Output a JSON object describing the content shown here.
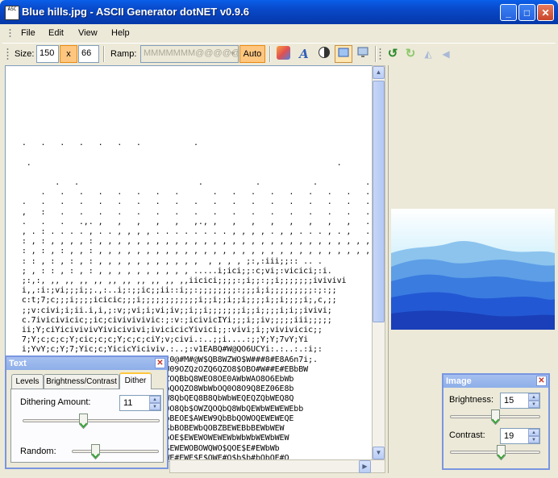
{
  "window": {
    "title": "Blue hills.jpg - ASCII Generator dotNET v0.9.6",
    "app_icon_text": "ASC",
    "controls": {
      "minimize": "_",
      "maximize": "□",
      "close": "✕"
    }
  },
  "menu": {
    "items": [
      "File",
      "Edit",
      "View",
      "Help"
    ]
  },
  "toolbar": {
    "size_label": "Size:",
    "width": "150",
    "times": "x",
    "height": "66",
    "ramp_label": "Ramp:",
    "ramp_value": "MMMMMMM@@@@@",
    "auto_label": "Auto",
    "icons": [
      "gradient-icon",
      "font-icon",
      "invert-icon",
      "fit-icon",
      "display-icon",
      "rotate-left-icon",
      "rotate-right-icon",
      "flip-horizontal-icon",
      "flip-vertical-icon"
    ]
  },
  "ascii_output": [
    "",
    "  .   .   .   .   .   .   .           .",
    "",
    "   .                                                                .",
    "                                                                              .",
    "         .   .                         .           .           .          .",
    "      .   .   .   .   .   .   .   .       .   .   .   .   .   .   .   .   .",
    "  .   .   .   .   .   .   .   .   .   .   .   .   .   .   .   .   .   .   .",
    "  ,   :   .   .   .   .   .   .   .   .   .   .   .   .   .   .   .   .   .",
    "  .   .   .   .,. ,   ,   ,   ,   ,   ,., ,   ,   ,   ,   ,   ,   ,   ,   .",
    "  , . : . . . . , . . , , , , . . . . . . . . , , , , . , , . . . , . ,   .",
    "  : , : , , , , : , , , , , , , , , , , , , , , , , , , , , , , , , , , , ,",
    "  : , : , : , , : , , , , , , , , , , , , , , , , , , , , , , , , , , , , ,",
    "  : : , : , : , : , , , , , , , , , , ,  , , , , ;:,:iii;;:: .. .",
    "  ; , : : , : , : , , , , , , , , , , .....i;ici;;:c;vi;:vicici;:i.",
    "  ;:,:, ,, ,, ,, ,, ,, ,, ,, ,, ,, ,,iicici;;;;:;i;;:;;i;;;;;;;ivivivi",
    "  i,,:i:;vi;;;i;;.,:..i;:;;ic;;ii::i;;:;;;;;;;;:;;;i;i;;;;;;;;;:;:;;",
    "  c:t;7;c;;;i;;;;icicic;;;i;;;;;;;;;;;;i;;i;;i;;i;;;;i;;i;;;;i;,c,;;",
    "  ;;v:civi;i;ii.i,i,;:v;;vi;i;vi;iv;;i;;i;;;;;;;i;;i;;;;i;i;;ivivi;",
    "  c.7ivicivicic;;ic;civivivivic:;:v:;icivicIYi;;;i;;iv;;;;;iii;;;;;",
    "  ii;Y;ciYicivivivYivicivivi;ivicicicYivici;;:vivi;i;;vivivicic;;",
    "  7;Y;c;c;c;Y;cic;c;c;Y;c;c;ciY;v;civi.:..;;i....:;;Y;Y;7vY;Yi",
    "  i;YvY;c;Y;7;Yic;c;YicicYiciviv.:..;:v1EABQ#W@QO6UCYi:.:..:.:i;:",
    "  BQEWWWBBbbbQBWEWWB#ZEB@bbbii77t0@#M#@W$QB8WZWO$W###8#E8A6n7i;.",
    "  @#QB#E#EbWEB#QEW#8@M#@M@#$bObWU09OZQzOZQ6QZO8$OBO#W##E#EBbBW",
    "  @@#EWE@EWEEWWQWQEE#@#WZQ9QABABZOQBbQ8WEO8OE0AWbWAO8O6EbWb",
    "  BWbQOZQEQbOZQBQ$BObWEW9Q9WEWbWbQOQZO8WbWbOQ0O8O9Q8EZ06E8b",
    "  $OQ$Q$B$bQZOQ$QOEWBbBEQEWEW8W9W8QbQEQ8B8QbWbWEQEQZQbWEQ8Q",
    "  BWEWbWEWBWbBEEOQZ0BQZOQEWEQOOE0O8Qb$OWZQOQbQ8WbQEWbWEWEWEbb",
    "  BEWEWbWEWEWbWbWEWbBBbWbWE$bBEBbBEOE$AWEW9QbBbQOWOQEWEWEQE",
    "  WEWbWEWEWbWEWEWbBBbEWEWbBbQEBO$bBOBEWbQOBZBEWEBbBEWbWEW",
    "  OBEWbQEBEWEWEWEWbWBEWBE$O$EQE$bOE$EWEWOWEWEWbWbWbWEWbWEW",
    "  QWEWEWEWBbWEWEWEWEWE$QQ0BO#0QE$EWEWOBOWQWO$QOE$E#EWbWb",
    "  EWbBEWEWbWEWE$EWEWbE$OWE$bBEWOWE#EWE$E$OWE#O$b$b#bObOE#O"
  ],
  "text_panel": {
    "title": "Text",
    "tabs": [
      "Levels",
      "Brightness/Contrast",
      "Dither"
    ],
    "active_tab": 2,
    "dithering_label": "Dithering Amount:",
    "dithering_value": "11",
    "dithering_level": 0.44,
    "random_label": "Random:",
    "random_value": 0.25
  },
  "image_panel": {
    "title": "Image",
    "brightness_label": "Brightness:",
    "brightness_value": "15",
    "brightness_level": 0.5,
    "contrast_label": "Contrast:",
    "contrast_value": "19",
    "contrast_level": 0.57
  },
  "colors": {
    "title_blue": "#0848c8",
    "toggle_orange": "#ffc680",
    "panel_border": "#7a96df",
    "sky": "#dff4fc",
    "hills": "#1a4fd8"
  }
}
